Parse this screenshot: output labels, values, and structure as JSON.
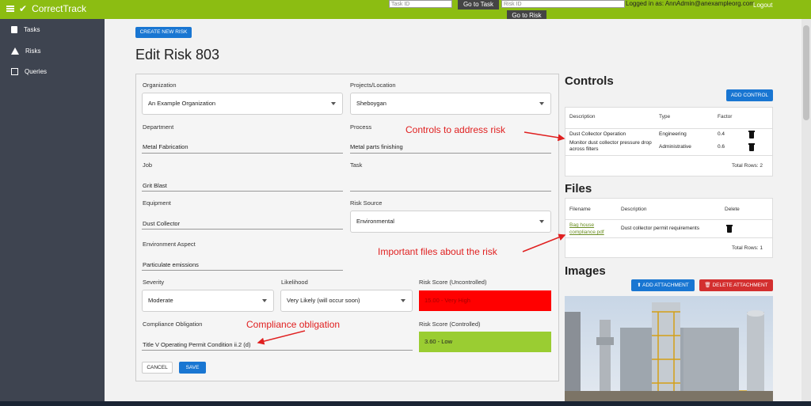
{
  "app": {
    "name": "CorrectTrack"
  },
  "topbar": {
    "task_placeholder": "Task ID",
    "go_task": "Go to Task",
    "risk_placeholder": "Risk ID",
    "go_risk": "Go to Risk",
    "logged_in": "Logged in as: AnnAdmin@anexampleorg.com",
    "logout": "Logout"
  },
  "sidebar": {
    "items": [
      {
        "label": "Tasks",
        "icon": "document-icon"
      },
      {
        "label": "Risks",
        "icon": "warning-icon"
      },
      {
        "label": "Queries",
        "icon": "square-icon"
      }
    ]
  },
  "page": {
    "create_button": "CREATE NEW RISK",
    "title": "Edit Risk 803"
  },
  "form": {
    "organization": {
      "label": "Organization",
      "value": "An Example Organization"
    },
    "projects": {
      "label": "Projects/Location",
      "value": "Sheboygan"
    },
    "department": {
      "label": "Department",
      "value": "Metal Fabrication"
    },
    "process": {
      "label": "Process",
      "value": "Metal parts finishing"
    },
    "job": {
      "label": "Job",
      "value": "Grit Blast"
    },
    "task": {
      "label": "Task",
      "value": ""
    },
    "equipment": {
      "label": "Equipment",
      "value": "Dust Collector"
    },
    "risk_source": {
      "label": "Risk Source",
      "value": "Environmental"
    },
    "environment_aspect": {
      "label": "Environment Aspect",
      "value": "Particulate emissions"
    },
    "severity": {
      "label": "Severity",
      "value": "Moderate"
    },
    "likelihood": {
      "label": "Likelihood",
      "value": "Very Likely (will occur soon)"
    },
    "risk_uncontrolled": {
      "label": "Risk Score (Uncontrolled)",
      "value": "15.00 - Very High",
      "color": "#ff0000"
    },
    "compliance": {
      "label": "Compliance Obligation",
      "value": "Title V Operating Permit Condition ii.2 (d)"
    },
    "risk_controlled": {
      "label": "Risk Score (Controlled)",
      "value": "3.60 - Low",
      "color": "#9acd32"
    },
    "cancel": "CANCEL",
    "save": "SAVE"
  },
  "controls": {
    "title": "Controls",
    "add_button": "ADD CONTROL",
    "headers": [
      "Description",
      "Type",
      "Factor"
    ],
    "rows": [
      {
        "description": "Dust Collector Operation",
        "type": "Engineering",
        "factor": "0.4"
      },
      {
        "description": "Monitor dust collector pressure drop across filters",
        "type": "Administrative",
        "factor": "0.6"
      }
    ],
    "total": "Total Rows: 2"
  },
  "files": {
    "title": "Files",
    "headers": [
      "Filename",
      "Description",
      "Delete"
    ],
    "rows": [
      {
        "filename": "Bag house compliance.pdf",
        "description": "Dust collector permit requirements"
      }
    ],
    "total": "Total Rows: 1"
  },
  "images": {
    "title": "Images",
    "add_button": "ADD ATTACHMENT",
    "delete_button": "DELETE ATTACHMENT"
  },
  "annotations": {
    "controls": "Controls to address risk",
    "files": "Important files about the risk",
    "compliance": "Compliance obligation"
  },
  "colors": {
    "brand": "#8cbd12",
    "primary": "#1976d2",
    "danger": "#d32f2f",
    "annotation": "#e02020"
  }
}
